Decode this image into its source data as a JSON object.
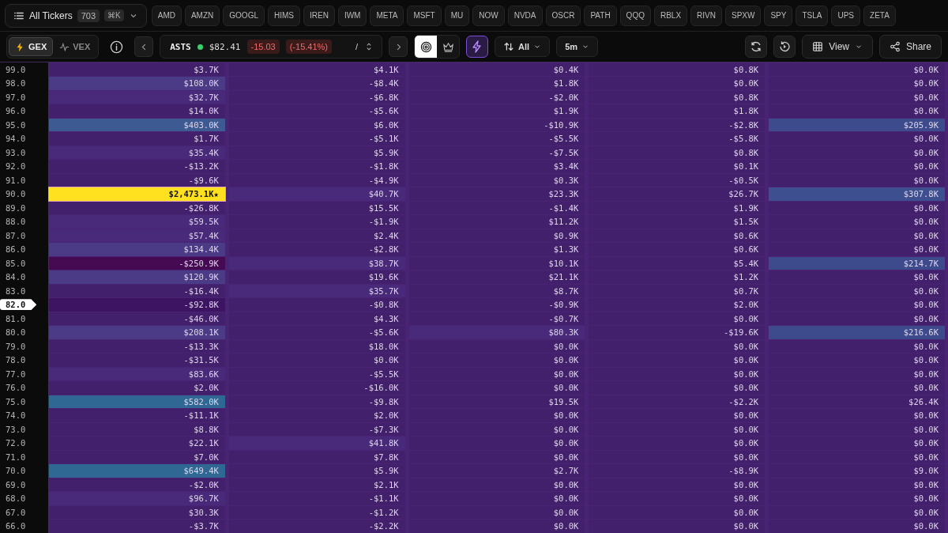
{
  "ticker_picker": {
    "label": "All Tickers",
    "count": "703",
    "shortcut": "⌘K"
  },
  "tickers": [
    "AMD",
    "AMZN",
    "GOOGL",
    "HIMS",
    "IREN",
    "IWM",
    "META",
    "MSFT",
    "MU",
    "NOW",
    "NVDA",
    "OSCR",
    "PATH",
    "QQQ",
    "RBLX",
    "RIVN",
    "SPXW",
    "SPY",
    "TSLA",
    "UPS",
    "ZETA"
  ],
  "mode_toggle": [
    {
      "label": "GEX",
      "kind": "gex",
      "selected": true
    },
    {
      "label": "VEX",
      "kind": "vex",
      "selected": false
    }
  ],
  "quote": {
    "symbol": "ASTS",
    "live": true,
    "price": "$82.41",
    "change": "-15.03",
    "change_pct": "(-15.41%)",
    "separator": "/"
  },
  "view_toggle": [
    {
      "kind": "target",
      "selected": true
    },
    {
      "kind": "crown",
      "selected": false
    }
  ],
  "flash": {
    "on": true
  },
  "sort_filter": {
    "label": "All"
  },
  "interval": {
    "label": "5m"
  },
  "buttons": [
    {
      "label": "View",
      "kind": "view"
    },
    {
      "label": "Share",
      "kind": "share"
    }
  ],
  "rows": [
    {
      "strike": "99.0",
      "current": false,
      "cells": [
        {
          "v": "$3.7K",
          "color": "#43206b"
        },
        {
          "v": "$4.1K",
          "color": "#43206b"
        },
        {
          "v": "$0.4K",
          "color": "#43206b"
        },
        {
          "v": "$0.8K",
          "color": "#43206b"
        },
        {
          "v": "$0.0K",
          "color": "#43206b"
        }
      ]
    },
    {
      "strike": "98.0",
      "current": false,
      "cells": [
        {
          "v": "$108.0K",
          "color": "#4b3a85"
        },
        {
          "v": "-$8.4K",
          "color": "#43206b"
        },
        {
          "v": "$1.8K",
          "color": "#43206b"
        },
        {
          "v": "$0.0K",
          "color": "#43206b"
        },
        {
          "v": "$0.0K",
          "color": "#43206b"
        }
      ]
    },
    {
      "strike": "97.0",
      "current": false,
      "cells": [
        {
          "v": "$32.7K",
          "color": "#48297a"
        },
        {
          "v": "-$6.8K",
          "color": "#43206b"
        },
        {
          "v": "-$2.0K",
          "color": "#43206b"
        },
        {
          "v": "$0.8K",
          "color": "#43206b"
        },
        {
          "v": "$0.0K",
          "color": "#43206b"
        }
      ]
    },
    {
      "strike": "96.0",
      "current": false,
      "cells": [
        {
          "v": "$14.0K",
          "color": "#43206b"
        },
        {
          "v": "-$5.6K",
          "color": "#43206b"
        },
        {
          "v": "$1.9K",
          "color": "#43206b"
        },
        {
          "v": "$1.8K",
          "color": "#43206b"
        },
        {
          "v": "$0.0K",
          "color": "#43206b"
        }
      ]
    },
    {
      "strike": "95.0",
      "current": false,
      "cells": [
        {
          "v": "$403.0K",
          "color": "#3e5a92"
        },
        {
          "v": "$6.0K",
          "color": "#43206b"
        },
        {
          "v": "-$10.9K",
          "color": "#43206b"
        },
        {
          "v": "-$2.8K",
          "color": "#43206b"
        },
        {
          "v": "$205.9K",
          "color": "#3d4a8c"
        }
      ]
    },
    {
      "strike": "94.0",
      "current": false,
      "cells": [
        {
          "v": "$1.7K",
          "color": "#43206b"
        },
        {
          "v": "-$5.1K",
          "color": "#43206b"
        },
        {
          "v": "-$5.5K",
          "color": "#43206b"
        },
        {
          "v": "-$5.8K",
          "color": "#43206b"
        },
        {
          "v": "$0.0K",
          "color": "#43206b"
        }
      ]
    },
    {
      "strike": "93.0",
      "current": false,
      "cells": [
        {
          "v": "$35.4K",
          "color": "#48297a"
        },
        {
          "v": "$5.9K",
          "color": "#43206b"
        },
        {
          "v": "-$7.5K",
          "color": "#43206b"
        },
        {
          "v": "$0.8K",
          "color": "#43206b"
        },
        {
          "v": "$0.0K",
          "color": "#43206b"
        }
      ]
    },
    {
      "strike": "92.0",
      "current": false,
      "cells": [
        {
          "v": "-$13.2K",
          "color": "#43206b"
        },
        {
          "v": "-$1.8K",
          "color": "#43206b"
        },
        {
          "v": "$3.4K",
          "color": "#43206b"
        },
        {
          "v": "$0.1K",
          "color": "#43206b"
        },
        {
          "v": "$0.0K",
          "color": "#43206b"
        }
      ]
    },
    {
      "strike": "91.0",
      "current": false,
      "cells": [
        {
          "v": "-$9.6K",
          "color": "#43206b"
        },
        {
          "v": "-$4.9K",
          "color": "#43206b"
        },
        {
          "v": "$0.3K",
          "color": "#43206b"
        },
        {
          "v": "-$0.5K",
          "color": "#43206b"
        },
        {
          "v": "$0.0K",
          "color": "#43206b"
        }
      ]
    },
    {
      "strike": "90.0",
      "current": false,
      "cells": [
        {
          "v": "$2,473.1K★",
          "color": "#ffe11f"
        },
        {
          "v": "$40.7K",
          "color": "#48297a"
        },
        {
          "v": "$23.3K",
          "color": "#43206b"
        },
        {
          "v": "$26.7K",
          "color": "#43206b"
        },
        {
          "v": "$307.8K",
          "color": "#3d4f8e"
        }
      ]
    },
    {
      "strike": "89.0",
      "current": false,
      "cells": [
        {
          "v": "-$26.8K",
          "color": "#43206b"
        },
        {
          "v": "$15.5K",
          "color": "#43206b"
        },
        {
          "v": "-$1.4K",
          "color": "#43206b"
        },
        {
          "v": "$1.9K",
          "color": "#43206b"
        },
        {
          "v": "$0.0K",
          "color": "#43206b"
        }
      ]
    },
    {
      "strike": "88.0",
      "current": false,
      "cells": [
        {
          "v": "$59.5K",
          "color": "#48297a"
        },
        {
          "v": "-$1.9K",
          "color": "#43206b"
        },
        {
          "v": "$11.2K",
          "color": "#43206b"
        },
        {
          "v": "$1.5K",
          "color": "#43206b"
        },
        {
          "v": "$0.0K",
          "color": "#43206b"
        }
      ]
    },
    {
      "strike": "87.0",
      "current": false,
      "cells": [
        {
          "v": "$57.4K",
          "color": "#48297a"
        },
        {
          "v": "$2.4K",
          "color": "#43206b"
        },
        {
          "v": "$0.9K",
          "color": "#43206b"
        },
        {
          "v": "$0.6K",
          "color": "#43206b"
        },
        {
          "v": "$0.0K",
          "color": "#43206b"
        }
      ]
    },
    {
      "strike": "86.0",
      "current": false,
      "cells": [
        {
          "v": "$134.4K",
          "color": "#4b3a85"
        },
        {
          "v": "-$2.8K",
          "color": "#43206b"
        },
        {
          "v": "$1.3K",
          "color": "#43206b"
        },
        {
          "v": "$0.6K",
          "color": "#43206b"
        },
        {
          "v": "$0.0K",
          "color": "#43206b"
        }
      ]
    },
    {
      "strike": "85.0",
      "current": false,
      "cells": [
        {
          "v": "-$250.9K",
          "color": "#460a52"
        },
        {
          "v": "$38.7K",
          "color": "#48297a"
        },
        {
          "v": "$10.1K",
          "color": "#43206b"
        },
        {
          "v": "$5.4K",
          "color": "#43206b"
        },
        {
          "v": "$214.7K",
          "color": "#3d4a8c"
        }
      ]
    },
    {
      "strike": "84.0",
      "current": false,
      "cells": [
        {
          "v": "$120.9K",
          "color": "#4b3a85"
        },
        {
          "v": "$19.6K",
          "color": "#43206b"
        },
        {
          "v": "$21.1K",
          "color": "#43206b"
        },
        {
          "v": "$1.2K",
          "color": "#43206b"
        },
        {
          "v": "$0.0K",
          "color": "#43206b"
        }
      ]
    },
    {
      "strike": "83.0",
      "current": false,
      "cells": [
        {
          "v": "-$16.4K",
          "color": "#43206b"
        },
        {
          "v": "$35.7K",
          "color": "#48297a"
        },
        {
          "v": "$8.7K",
          "color": "#43206b"
        },
        {
          "v": "$0.7K",
          "color": "#43206b"
        },
        {
          "v": "$0.0K",
          "color": "#43206b"
        }
      ]
    },
    {
      "strike": "82.0",
      "current": true,
      "cells": [
        {
          "v": "-$92.8K",
          "color": "#3d1462"
        },
        {
          "v": "-$0.8K",
          "color": "#43206b"
        },
        {
          "v": "-$0.9K",
          "color": "#43206b"
        },
        {
          "v": "$2.0K",
          "color": "#43206b"
        },
        {
          "v": "$0.0K",
          "color": "#43206b"
        }
      ]
    },
    {
      "strike": "81.0",
      "current": false,
      "cells": [
        {
          "v": "-$46.0K",
          "color": "#43206b"
        },
        {
          "v": "$4.3K",
          "color": "#43206b"
        },
        {
          "v": "-$0.7K",
          "color": "#43206b"
        },
        {
          "v": "$0.0K",
          "color": "#43206b"
        },
        {
          "v": "$0.0K",
          "color": "#43206b"
        }
      ]
    },
    {
      "strike": "80.0",
      "current": false,
      "cells": [
        {
          "v": "$208.1K",
          "color": "#4b3a85"
        },
        {
          "v": "-$5.6K",
          "color": "#43206b"
        },
        {
          "v": "$80.3K",
          "color": "#48297a"
        },
        {
          "v": "-$19.6K",
          "color": "#43206b"
        },
        {
          "v": "$216.6K",
          "color": "#3d4a8c"
        }
      ]
    },
    {
      "strike": "79.0",
      "current": false,
      "cells": [
        {
          "v": "-$13.3K",
          "color": "#43206b"
        },
        {
          "v": "$18.0K",
          "color": "#43206b"
        },
        {
          "v": "$0.0K",
          "color": "#43206b"
        },
        {
          "v": "$0.0K",
          "color": "#43206b"
        },
        {
          "v": "$0.0K",
          "color": "#43206b"
        }
      ]
    },
    {
      "strike": "78.0",
      "current": false,
      "cells": [
        {
          "v": "-$31.5K",
          "color": "#43206b"
        },
        {
          "v": "$0.0K",
          "color": "#43206b"
        },
        {
          "v": "$0.0K",
          "color": "#43206b"
        },
        {
          "v": "$0.0K",
          "color": "#43206b"
        },
        {
          "v": "$0.0K",
          "color": "#43206b"
        }
      ]
    },
    {
      "strike": "77.0",
      "current": false,
      "cells": [
        {
          "v": "$83.6K",
          "color": "#48297a"
        },
        {
          "v": "-$5.5K",
          "color": "#43206b"
        },
        {
          "v": "$0.0K",
          "color": "#43206b"
        },
        {
          "v": "$0.0K",
          "color": "#43206b"
        },
        {
          "v": "$0.0K",
          "color": "#43206b"
        }
      ]
    },
    {
      "strike": "76.0",
      "current": false,
      "cells": [
        {
          "v": "$2.0K",
          "color": "#43206b"
        },
        {
          "v": "-$16.0K",
          "color": "#43206b"
        },
        {
          "v": "$0.0K",
          "color": "#43206b"
        },
        {
          "v": "$0.0K",
          "color": "#43206b"
        },
        {
          "v": "$0.0K",
          "color": "#43206b"
        }
      ]
    },
    {
      "strike": "75.0",
      "current": false,
      "cells": [
        {
          "v": "$582.0K",
          "color": "#2f6893"
        },
        {
          "v": "-$9.8K",
          "color": "#43206b"
        },
        {
          "v": "$19.5K",
          "color": "#43206b"
        },
        {
          "v": "-$2.2K",
          "color": "#43206b"
        },
        {
          "v": "$26.4K",
          "color": "#43206b"
        }
      ]
    },
    {
      "strike": "74.0",
      "current": false,
      "cells": [
        {
          "v": "-$11.1K",
          "color": "#43206b"
        },
        {
          "v": "$2.0K",
          "color": "#43206b"
        },
        {
          "v": "$0.0K",
          "color": "#43206b"
        },
        {
          "v": "$0.0K",
          "color": "#43206b"
        },
        {
          "v": "$0.0K",
          "color": "#43206b"
        }
      ]
    },
    {
      "strike": "73.0",
      "current": false,
      "cells": [
        {
          "v": "$8.8K",
          "color": "#43206b"
        },
        {
          "v": "-$7.3K",
          "color": "#43206b"
        },
        {
          "v": "$0.0K",
          "color": "#43206b"
        },
        {
          "v": "$0.0K",
          "color": "#43206b"
        },
        {
          "v": "$0.0K",
          "color": "#43206b"
        }
      ]
    },
    {
      "strike": "72.0",
      "current": false,
      "cells": [
        {
          "v": "$22.1K",
          "color": "#43206b"
        },
        {
          "v": "$41.8K",
          "color": "#48297a"
        },
        {
          "v": "$0.0K",
          "color": "#43206b"
        },
        {
          "v": "$0.0K",
          "color": "#43206b"
        },
        {
          "v": "$0.0K",
          "color": "#43206b"
        }
      ]
    },
    {
      "strike": "71.0",
      "current": false,
      "cells": [
        {
          "v": "$7.0K",
          "color": "#43206b"
        },
        {
          "v": "$7.8K",
          "color": "#43206b"
        },
        {
          "v": "$0.0K",
          "color": "#43206b"
        },
        {
          "v": "$0.0K",
          "color": "#43206b"
        },
        {
          "v": "$0.0K",
          "color": "#43206b"
        }
      ]
    },
    {
      "strike": "70.0",
      "current": false,
      "cells": [
        {
          "v": "$649.4K",
          "color": "#2f6893"
        },
        {
          "v": "$5.9K",
          "color": "#43206b"
        },
        {
          "v": "$2.7K",
          "color": "#43206b"
        },
        {
          "v": "-$8.9K",
          "color": "#43206b"
        },
        {
          "v": "$9.0K",
          "color": "#43206b"
        }
      ]
    },
    {
      "strike": "69.0",
      "current": false,
      "cells": [
        {
          "v": "-$2.0K",
          "color": "#43206b"
        },
        {
          "v": "$2.1K",
          "color": "#43206b"
        },
        {
          "v": "$0.0K",
          "color": "#43206b"
        },
        {
          "v": "$0.0K",
          "color": "#43206b"
        },
        {
          "v": "$0.0K",
          "color": "#43206b"
        }
      ]
    },
    {
      "strike": "68.0",
      "current": false,
      "cells": [
        {
          "v": "$96.7K",
          "color": "#48297a"
        },
        {
          "v": "-$1.1K",
          "color": "#43206b"
        },
        {
          "v": "$0.0K",
          "color": "#43206b"
        },
        {
          "v": "$0.0K",
          "color": "#43206b"
        },
        {
          "v": "$0.0K",
          "color": "#43206b"
        }
      ]
    },
    {
      "strike": "67.0",
      "current": false,
      "cells": [
        {
          "v": "$30.3K",
          "color": "#43206b"
        },
        {
          "v": "-$1.2K",
          "color": "#43206b"
        },
        {
          "v": "$0.0K",
          "color": "#43206b"
        },
        {
          "v": "$0.0K",
          "color": "#43206b"
        },
        {
          "v": "$0.0K",
          "color": "#43206b"
        }
      ]
    },
    {
      "strike": "66.0",
      "current": false,
      "cells": [
        {
          "v": "-$3.7K",
          "color": "#43206b"
        },
        {
          "v": "-$2.2K",
          "color": "#43206b"
        },
        {
          "v": "$0.0K",
          "color": "#43206b"
        },
        {
          "v": "$0.0K",
          "color": "#43206b"
        },
        {
          "v": "$0.0K",
          "color": "#43206b"
        }
      ]
    }
  ]
}
